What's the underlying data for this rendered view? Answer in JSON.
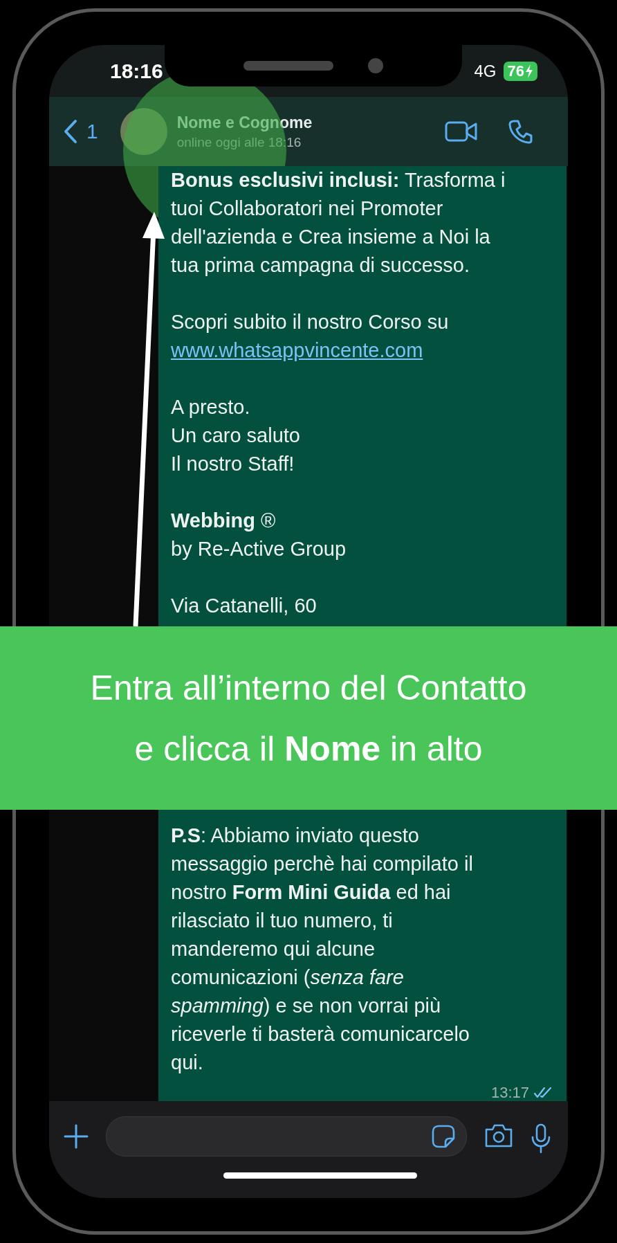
{
  "status_bar": {
    "time": "18:16",
    "network": "4G",
    "battery": "76"
  },
  "header": {
    "back_count": "1",
    "contact_name": "Nome e Cognome",
    "last_seen": "online oggi alle 18:16"
  },
  "message": {
    "paragraphs": [
      {
        "lines": [
          {
            "kind": "text",
            "text": "**Bonus esclusivi inclusi:** Trasforma i"
          },
          {
            "kind": "text",
            "text": "tuoi Collaboratori nei Promoter"
          },
          {
            "kind": "text",
            "text": "dell'azienda e Crea insieme a Noi la"
          },
          {
            "kind": "text",
            "text": "tua prima campagna di successo."
          }
        ]
      },
      {
        "lines": [
          {
            "kind": "text",
            "text": "Scopri subito il nostro Corso su"
          },
          {
            "kind": "link",
            "text": "www.whatsappvincente.com"
          }
        ]
      },
      {
        "lines": [
          {
            "kind": "text",
            "text": "A presto."
          },
          {
            "kind": "text",
            "text": "Un caro saluto"
          },
          {
            "kind": "text",
            "text": "Il nostro Staff!"
          }
        ]
      },
      {
        "lines": [
          {
            "kind": "text",
            "text": "**Webbing** ®"
          },
          {
            "kind": "text",
            "text": "by Re-Active Group"
          }
        ]
      },
      {
        "lines": [
          {
            "kind": "text",
            "text": "Via Catanelli, 60"
          }
        ]
      },
      {
        "lines": [
          {
            "kind": "text",
            "text": "**P.S**: Abbiamo inviato questo"
          },
          {
            "kind": "text",
            "text": "messaggio perchè hai compilato il"
          },
          {
            "kind": "text",
            "text": "nostro **Form Mini Guida** ed hai"
          },
          {
            "kind": "text",
            "text": "rilasciato il tuo numero, ti"
          },
          {
            "kind": "text",
            "text": "manderemo qui alcune"
          },
          {
            "kind": "text",
            "text": "comunicazioni (*senza fare*"
          },
          {
            "kind": "text",
            "text": "*spamming*) e se non vorrai più"
          },
          {
            "kind": "text",
            "text": "riceverle ti basterà comunicarcelo"
          },
          {
            "kind": "text",
            "text": "qui."
          }
        ]
      }
    ],
    "time": "13:17",
    "read": true
  },
  "banner": {
    "lines": [
      "Entra all’interno del Contatto",
      "e clicca il **Nome** in alto"
    ]
  }
}
